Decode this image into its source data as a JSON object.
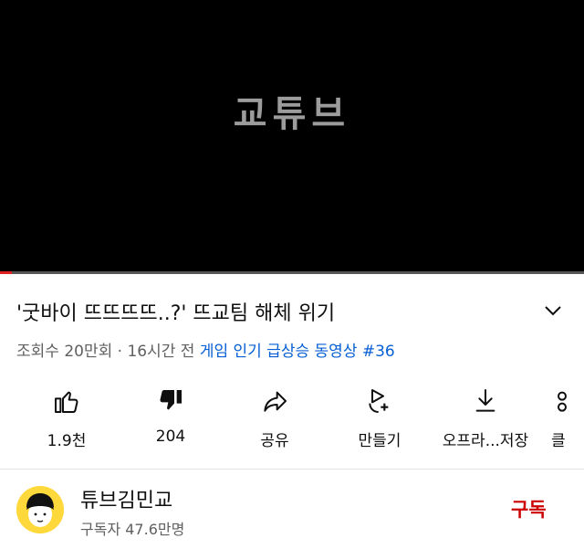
{
  "player": {
    "logo_text": "교튜브",
    "progress_fraction": 0.02
  },
  "video": {
    "title": "'굿바이 뜨뜨뜨뜨..?' 뜨교팀 해체 위기",
    "views": "조회수 20만회",
    "separator": " · ",
    "age": "16시간 전",
    "trending_tag": "게임 인기 급상승 동영상 #36"
  },
  "actions": [
    {
      "icon": "thumbs-up-icon",
      "label": "1.9천"
    },
    {
      "icon": "thumbs-down-icon",
      "label": "204"
    },
    {
      "icon": "share-icon",
      "label": "공유"
    },
    {
      "icon": "remix-icon",
      "label": "만들기"
    },
    {
      "icon": "download-icon",
      "label": "오프라...저장"
    },
    {
      "icon": "clip-icon",
      "label": "클"
    }
  ],
  "channel": {
    "name": "튜브김민교",
    "subscribers": "구독자 47.6만명",
    "subscribe_label": "구독"
  },
  "colors": {
    "accent": "#065fd4",
    "subscribe": "#cc0000",
    "progress": "#e02020"
  }
}
